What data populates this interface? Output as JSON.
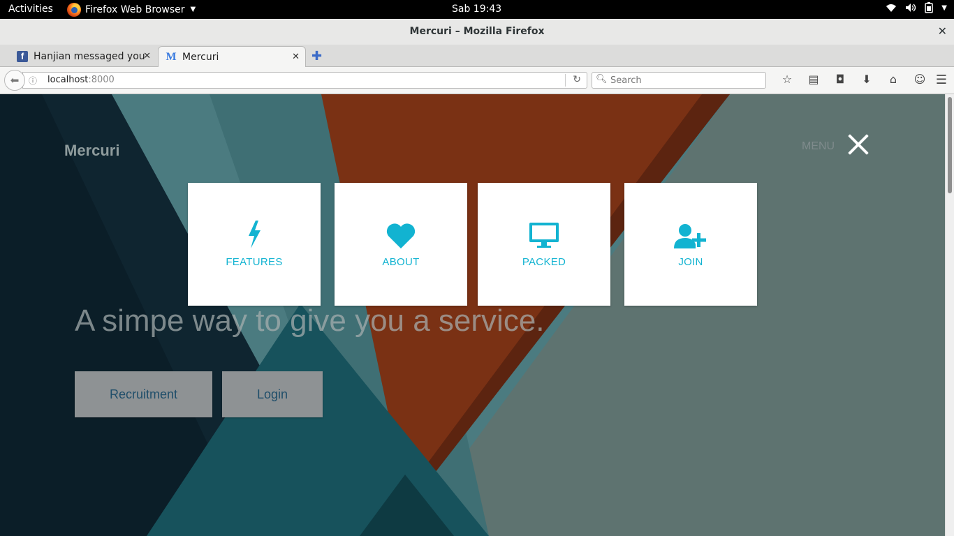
{
  "system_bar": {
    "activities": "Activities",
    "app_name": "Firefox Web Browser",
    "clock": "Sab 19:43"
  },
  "window": {
    "title": "Mercuri – Mozilla Firefox"
  },
  "tabs": [
    {
      "label": "Hanjian messaged you",
      "icon": "facebook-icon",
      "active": false
    },
    {
      "label": "Mercuri",
      "icon": "mercuri-favicon",
      "active": true
    }
  ],
  "navbar": {
    "url_host": "localhost",
    "url_port": ":8000",
    "search_placeholder": "Search"
  },
  "page": {
    "brand": "Mercuri",
    "menu_label": "MENU",
    "hero_text": "A simpe way to give you a service.",
    "buttons": {
      "recruitment": "Recruitment",
      "login": "Login"
    },
    "menu_cards": [
      {
        "label": "FEATURES",
        "icon": "lightning-bolt-icon"
      },
      {
        "label": "ABOUT",
        "icon": "heart-icon"
      },
      {
        "label": "PACKED",
        "icon": "monitor-icon"
      },
      {
        "label": "JOIN",
        "icon": "user-add-icon"
      }
    ]
  },
  "colors": {
    "accent": "#12b3d1",
    "page_bg": "#5e7370",
    "orange_stripe": "#7a3114",
    "dark_panel": "#0f2530"
  }
}
